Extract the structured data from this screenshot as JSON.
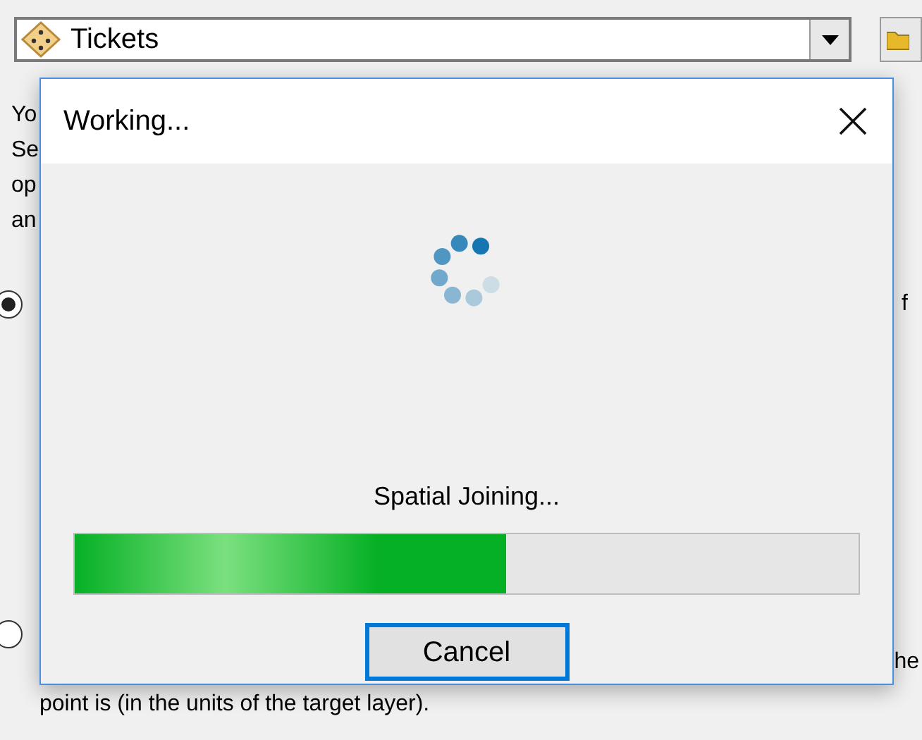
{
  "layer_select": {
    "value": "Tickets"
  },
  "background": {
    "fragments_left": [
      "Yo",
      "Se",
      "op",
      "an"
    ],
    "radios": [
      {
        "selected": true,
        "text": "f"
      },
      {
        "selected": false,
        "text": "he"
      }
    ],
    "bottom_text": "point is (in the units of the target layer)."
  },
  "dialog": {
    "title": "Working...",
    "status": "Spatial Joining...",
    "progress": {
      "level": 0.55
    },
    "buttons": [
      "Cancel"
    ]
  }
}
